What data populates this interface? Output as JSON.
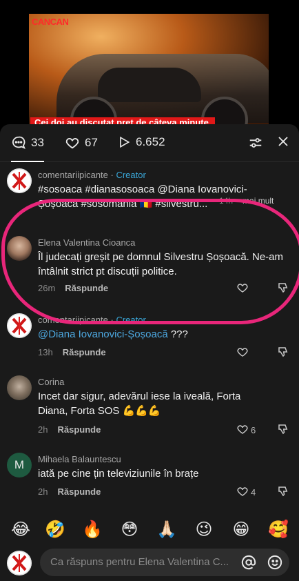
{
  "video": {
    "brand": "CANCAN",
    "caption": "Cei doi au discutat preț de câteva minute."
  },
  "stats": {
    "comments": "33",
    "likes": "67",
    "views": "6.652"
  },
  "comments": [
    {
      "username": "comentariipicante",
      "badge": "Creator",
      "text": "#sosoaca #dianasosoaca @Diana Iovanovici-Șoșoacă #sosomania 🇷🇴 #silvestru...",
      "time": "14h",
      "more": "mai mult"
    },
    {
      "username": "Elena Valentina Cioanca",
      "text": "Îl judecați greșit pe domnul Silvestru Șoșoacă. Ne-am întâlnit strict pt discuții politice.",
      "time": "26m",
      "reply": "Răspunde"
    },
    {
      "username": "comentariipicante",
      "badge": "Creator",
      "mention": "@Diana Iovanovici-Șoșoacă",
      "text_rest": " ???",
      "time": "13h",
      "reply": "Răspunde"
    },
    {
      "username": "Corina",
      "text": "Incet dar sigur, adevărul iese la iveală, Forta Diana, Forta SOS 💪💪💪",
      "time": "2h",
      "reply": "Răspunde",
      "likes": "6"
    },
    {
      "username": "Mihaela Balauntescu",
      "avatar_letter": "M",
      "text": "iată pe cine țin televiziunile în brațe",
      "time": "2h",
      "reply": "Răspunde",
      "likes": "4"
    }
  ],
  "emojis": [
    "😂",
    "🤣",
    "🔥",
    "😳",
    "🙏🏻",
    "😉",
    "😁",
    "🥰"
  ],
  "input": {
    "placeholder": "Ca răspuns pentru Elena Valentina C..."
  },
  "colors": {
    "highlight": "#e8267a",
    "creator": "#3aa7d8",
    "mention": "#4da8e0"
  }
}
